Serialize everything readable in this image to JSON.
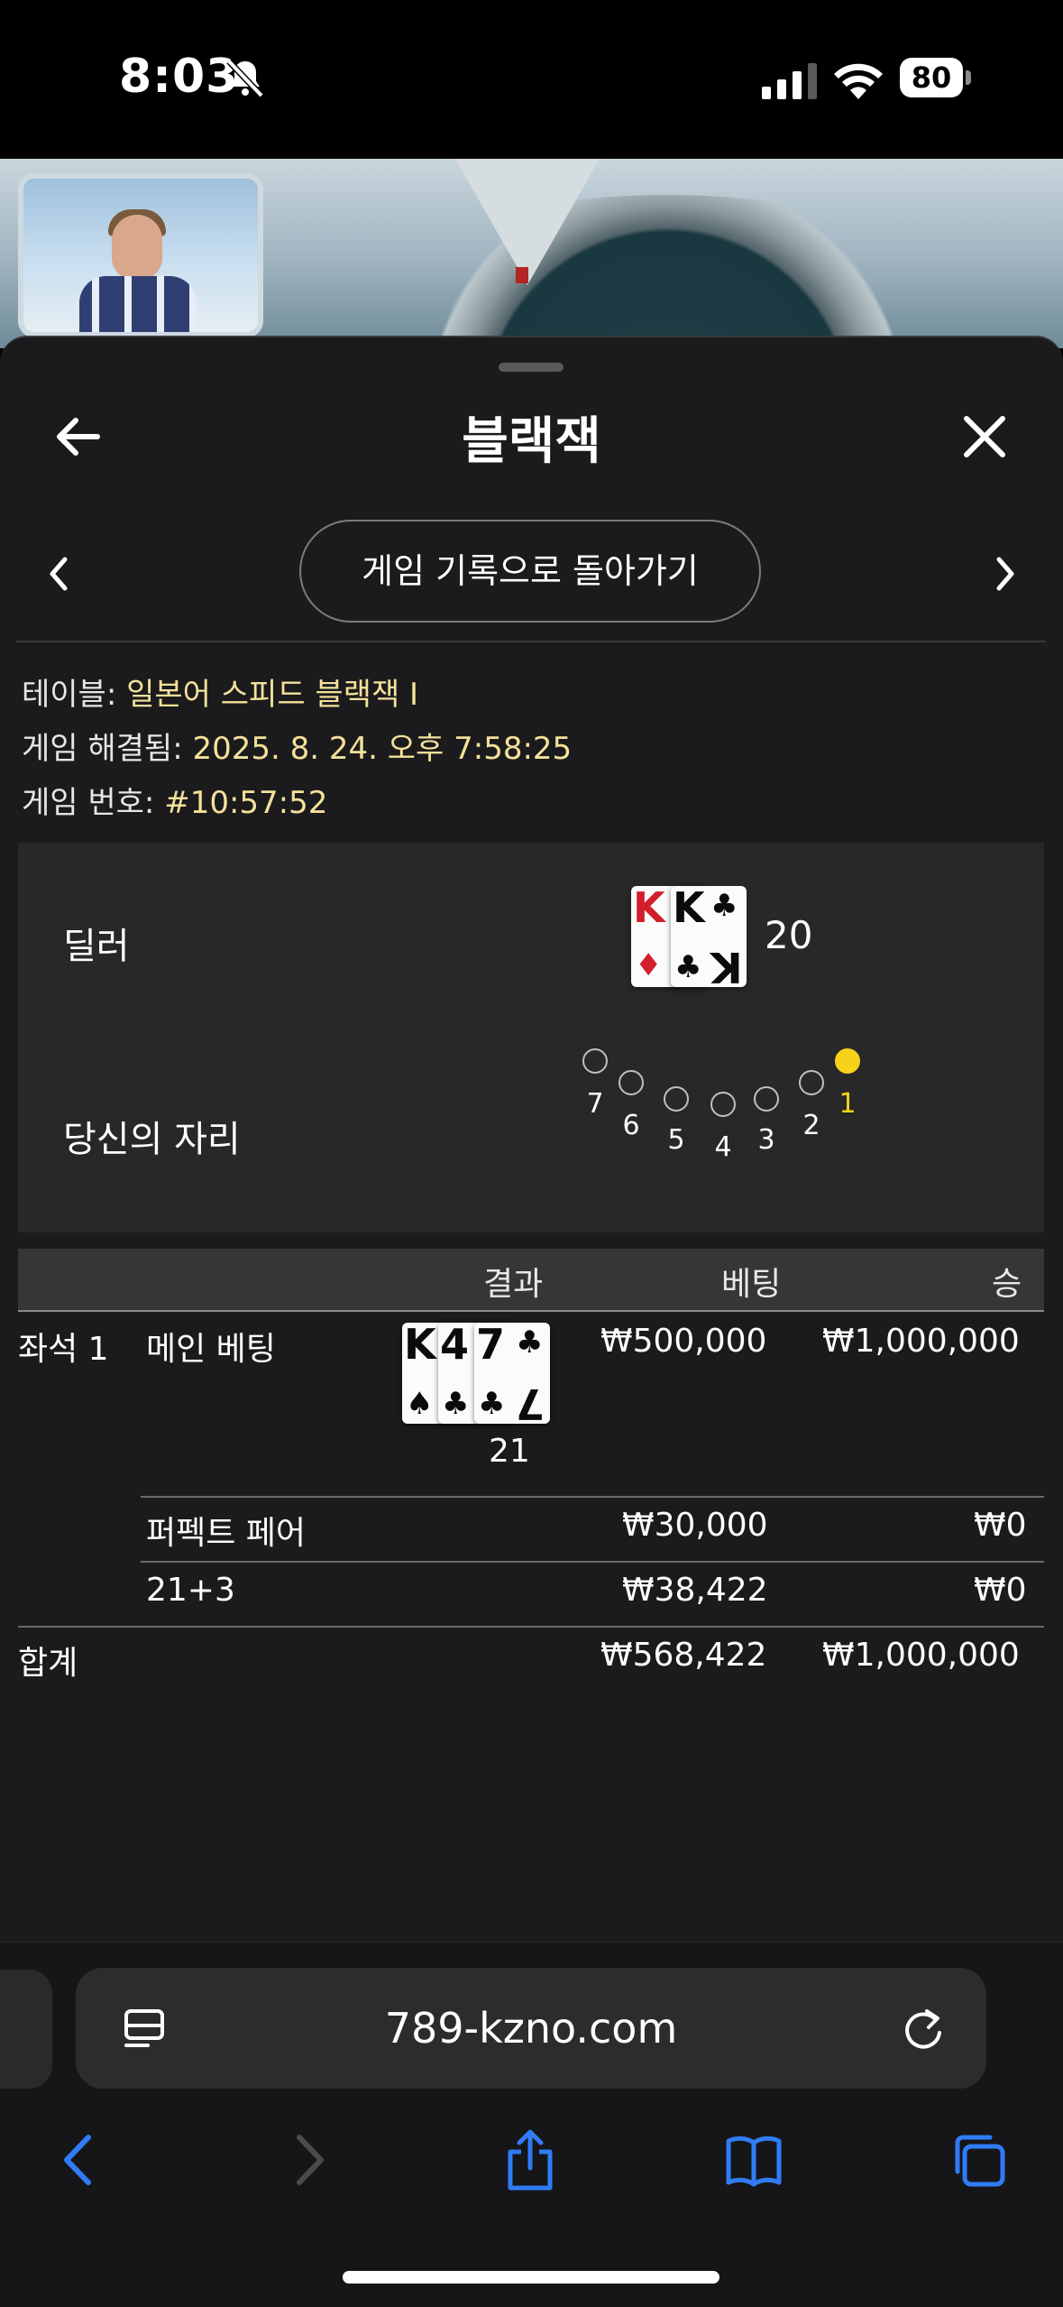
{
  "status_bar": {
    "time": "8:03",
    "battery": "80"
  },
  "sheet": {
    "title": "블랙잭",
    "back_to_history": "게임 기록으로 돌아가기"
  },
  "info": {
    "table_label": "테이블: ",
    "table_value": "일본어 스피드 블랙잭 I",
    "resolved_label": "게임 해결됨: ",
    "resolved_value": "2025. 8. 24. 오후 7:58:25",
    "game_no_label": "게임 번호: ",
    "game_no_value": "#10:57:52"
  },
  "dealer": {
    "label": "딜러",
    "cards": [
      {
        "rank": "K",
        "suit": "♦",
        "color": "red"
      },
      {
        "rank": "K",
        "suit": "♣",
        "color": "black"
      }
    ],
    "score": "20"
  },
  "seats": {
    "label": "당신의 자리",
    "numbers": [
      "7",
      "6",
      "5",
      "4",
      "3",
      "2",
      "1"
    ],
    "selected": "1"
  },
  "bets_table": {
    "headers": {
      "result": "결과",
      "bet": "베팅",
      "win": "승"
    },
    "seat_label": "좌석 1",
    "main": {
      "label": "메인 베팅",
      "cards": [
        {
          "rank": "K",
          "suit": "♠",
          "color": "black"
        },
        {
          "rank": "4",
          "suit": "♣",
          "color": "black"
        },
        {
          "rank": "7",
          "suit": "♣",
          "color": "black"
        }
      ],
      "score": "21",
      "bet": "₩500,000",
      "win": "₩1,000,000"
    },
    "perfect_pair": {
      "label": "퍼펙트 페어",
      "bet": "₩30,000",
      "win": "₩0"
    },
    "twenty_one_plus_three": {
      "label": "21+3",
      "bet": "₩38,422",
      "win": "₩0"
    },
    "total": {
      "label": "합계",
      "bet": "₩568,422",
      "win": "₩1,000,000"
    }
  },
  "browser": {
    "url": "789-kzno.com"
  },
  "colors": {
    "accent_yellow": "#f7d21a",
    "info_value": "#f4e19a",
    "ios_blue": "#2f7cf6"
  }
}
